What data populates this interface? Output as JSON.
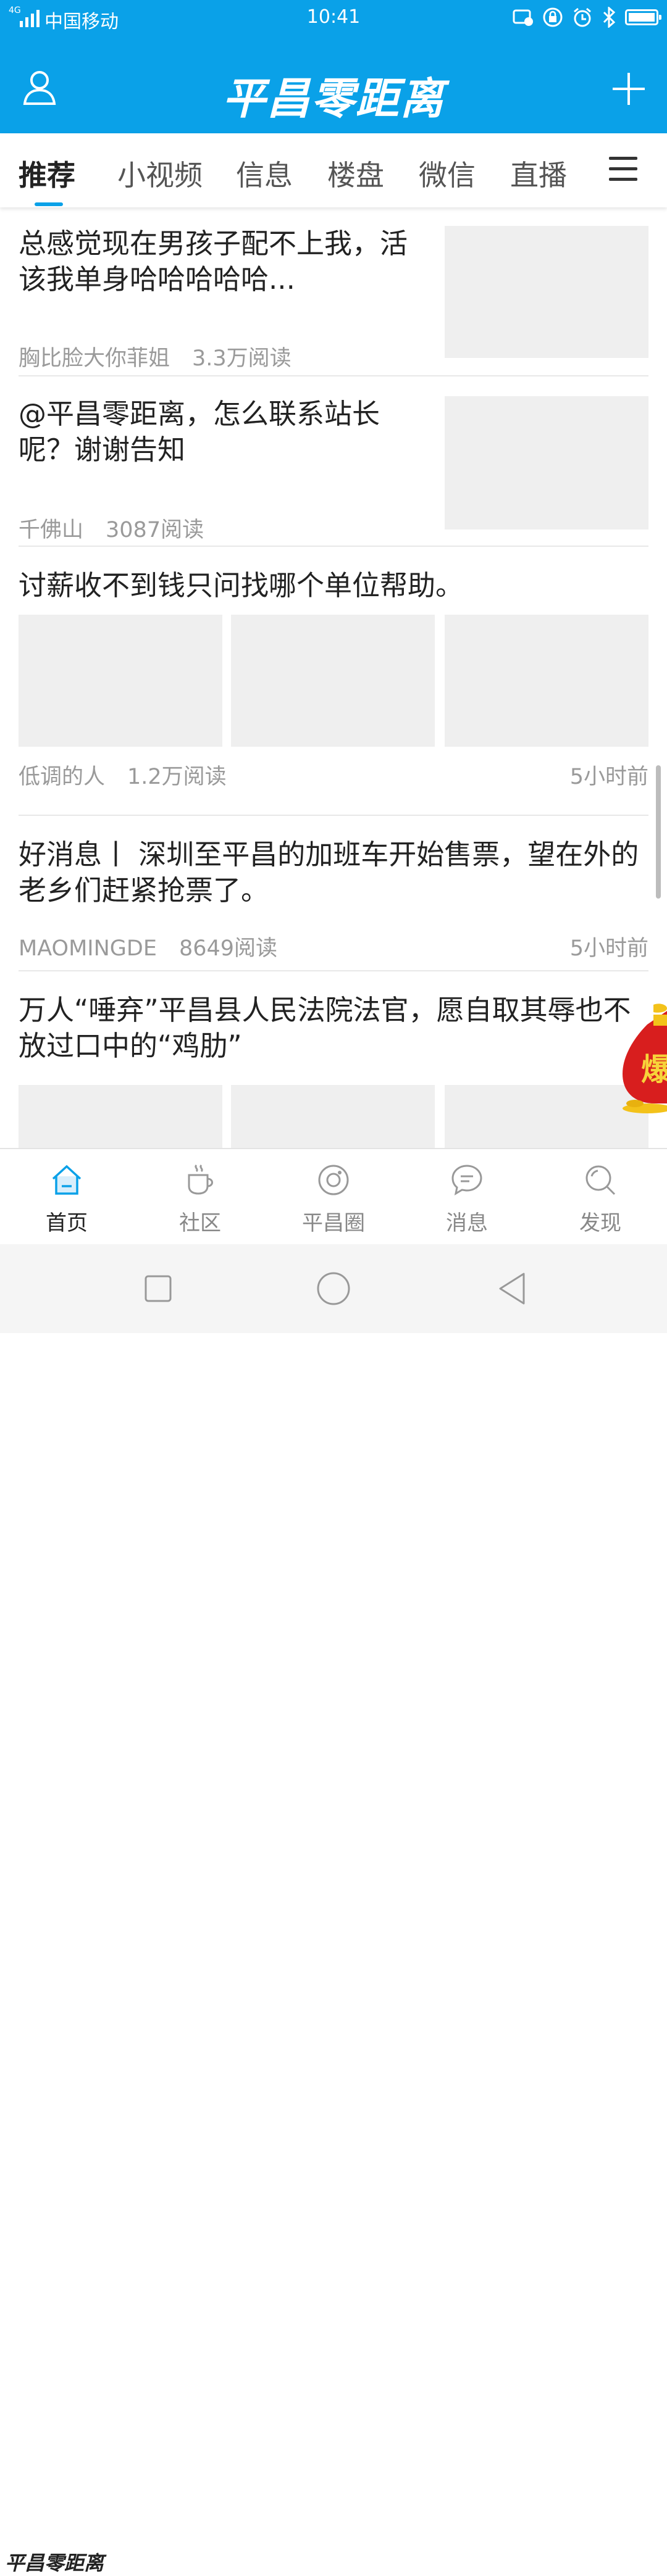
{
  "status_bar": {
    "network_type": "4G",
    "carrier": "中国移动",
    "time": "10:41"
  },
  "header": {
    "logo_text": "平昌零距离"
  },
  "tabs": [
    {
      "label": "推荐",
      "active": true
    },
    {
      "label": "小视频"
    },
    {
      "label": "信息"
    },
    {
      "label": "楼盘"
    },
    {
      "label": "微信"
    },
    {
      "label": "直播"
    }
  ],
  "feed": [
    {
      "title": "总感觉现在男孩子配不上我，活该我单身哈哈哈哈哈...",
      "author": "胸比脸大你菲姐",
      "reads": "3.3万阅读"
    },
    {
      "title": "@平昌零距离，怎么联系站长呢？谢谢告知",
      "author": "千佛山",
      "reads": "3087阅读"
    },
    {
      "title": "讨薪收不到钱只问找哪个单位帮助。",
      "author": "低调的人",
      "reads": "1.2万阅读",
      "time": "5小时前"
    },
    {
      "title": "好消息丨 深圳至平昌的加班车开始售票，望在外的老乡们赶紧抢票了。",
      "author": "MAOMINGDE",
      "reads": "8649阅读",
      "time": "5小时前"
    },
    {
      "title": "万人“唾弃”平昌县人民法院法官，愿自取其辱也不放过口中的“鸡肋”"
    }
  ],
  "promo_badge": "爆",
  "bottom_nav": [
    {
      "label": "首页",
      "icon": "home-icon",
      "active": true
    },
    {
      "label": "社区",
      "icon": "coffee-cup-icon"
    },
    {
      "label": "平昌圈",
      "icon": "circle-camera-icon"
    },
    {
      "label": "消息",
      "icon": "message-bubble-icon"
    },
    {
      "label": "发现",
      "icon": "search-discover-icon"
    }
  ],
  "watermark": "平昌零距离",
  "colors": {
    "brand_blue": "#0aa1e8",
    "placeholder_gray": "#efefef",
    "meta_gray": "#9a9a9a"
  }
}
